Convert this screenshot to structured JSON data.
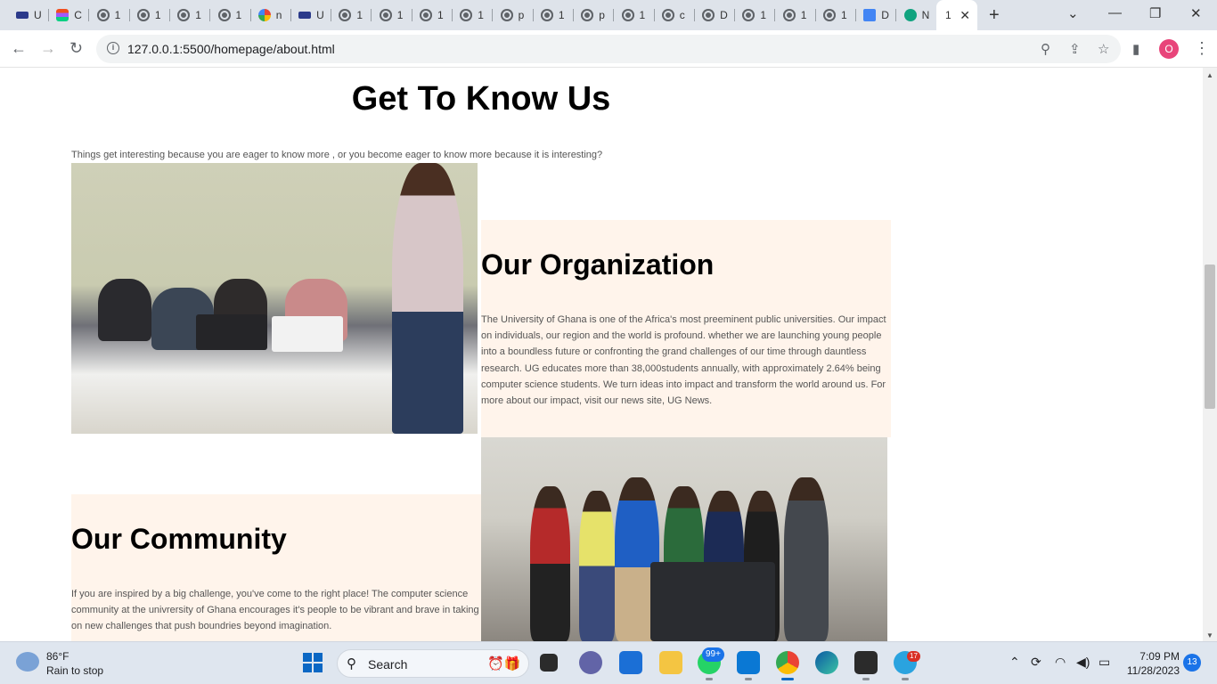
{
  "browser": {
    "tabs": [
      {
        "label": "U",
        "icon": "ug-logo-icon"
      },
      {
        "label": "C",
        "icon": "figma-icon"
      },
      {
        "label": "1",
        "icon": "globe-icon"
      },
      {
        "label": "1",
        "icon": "globe-icon"
      },
      {
        "label": "1",
        "icon": "globe-icon"
      },
      {
        "label": "1",
        "icon": "globe-icon"
      },
      {
        "label": "n",
        "icon": "google-icon"
      },
      {
        "label": "U",
        "icon": "ug-logo-icon"
      },
      {
        "label": "1",
        "icon": "globe-icon"
      },
      {
        "label": "1",
        "icon": "globe-icon"
      },
      {
        "label": "1",
        "icon": "globe-icon"
      },
      {
        "label": "1",
        "icon": "globe-icon"
      },
      {
        "label": "p",
        "icon": "globe-icon"
      },
      {
        "label": "1",
        "icon": "globe-icon"
      },
      {
        "label": "p",
        "icon": "globe-icon"
      },
      {
        "label": "1",
        "icon": "globe-icon"
      },
      {
        "label": "c",
        "icon": "globe-icon"
      },
      {
        "label": "D",
        "icon": "globe-icon"
      },
      {
        "label": "1",
        "icon": "globe-icon"
      },
      {
        "label": "1",
        "icon": "globe-icon"
      },
      {
        "label": "1",
        "icon": "globe-icon"
      },
      {
        "label": "D",
        "icon": "docs-icon"
      },
      {
        "label": "N",
        "icon": "chatgpt-icon"
      }
    ],
    "active_tab": {
      "label": "1"
    },
    "url": "127.0.0.1:5500/homepage/about.html",
    "profile_initial": "O"
  },
  "page": {
    "title": "Get To Know Us",
    "intro": "Things get interesting because you are eager to know more , or you become eager to know more because it is interesting?",
    "organization": {
      "heading": "Our Organization",
      "body": "The University of Ghana is one of the Africa's most preeminent public universities. Our impact on individuals, our region and the world is profound. whether we are launching young people into a boundless future or confronting the grand challenges of our time through dauntless research. UG educates more than 38,000students annually, with approximately 2.64% being computer science students. We turn ideas into impact and transform the world around us. For more about our impact, visit our news site, UG News."
    },
    "community": {
      "heading": "Our Community",
      "body": "If you are inspired by a big challenge, you've come to the right place! The computer science community at the univrersity of Ghana encourages it's people to be vibrant and brave in taking on new challenges that push boundries beyond imagination."
    }
  },
  "taskbar": {
    "weather_temp": "86°F",
    "weather_desc": "Rain to stop",
    "search_label": "Search",
    "whatsapp_badge": "99+",
    "telegram_badge": "17",
    "time": "7:09 PM",
    "date": "11/28/2023",
    "notification_count": "13"
  }
}
